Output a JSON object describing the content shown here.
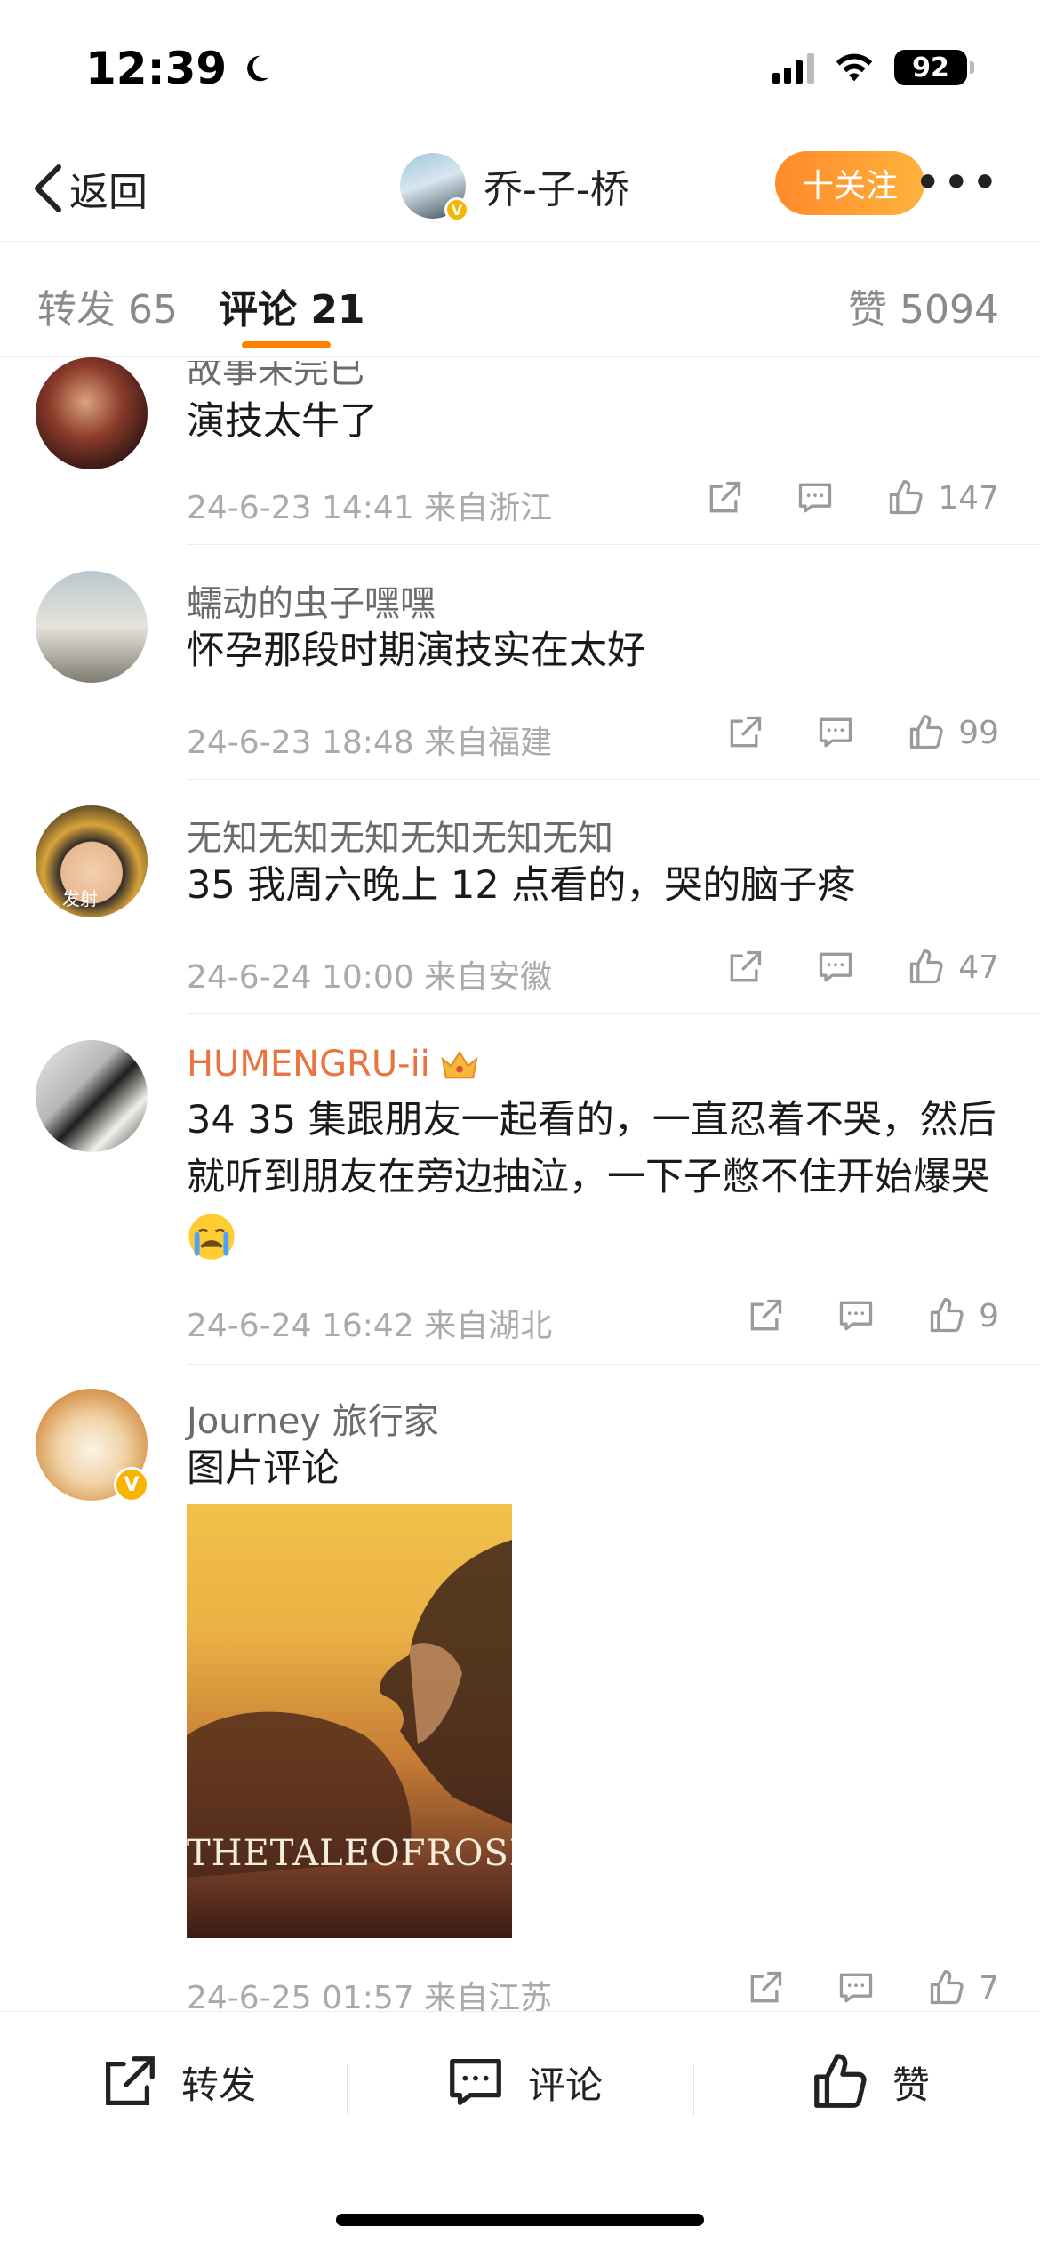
{
  "status_bar": {
    "time": "12:39",
    "battery": "92"
  },
  "nav": {
    "back_label": "返回",
    "username": "乔-子-桥",
    "follow_label": "十关注",
    "more": "•••"
  },
  "tabs": {
    "repost": "转发 65",
    "comments": "评论 21",
    "likes": "赞 5094",
    "accent": "#ff8200"
  },
  "comments": [
    {
      "name": "故事未完已",
      "text": "演技太牛了",
      "date": "24-6-23 14:41",
      "location": "来自浙江",
      "likes": "147"
    },
    {
      "name": "蠕动的虫子嘿嘿",
      "text": "怀孕那段时期演技实在太好",
      "date": "24-6-23 18:48",
      "location": "来自福建",
      "likes": "99"
    },
    {
      "name": "无知无知无知无知无知无知",
      "text": "35 我周六晚上 12 点看的，哭的脑子疼",
      "date": "24-6-24 10:00",
      "location": "来自安徽",
      "likes": "47",
      "avatar_caption": "发射"
    },
    {
      "name": "HUMENGRU-ii",
      "text": "34 35 集跟朋友一起看的，一直忍着不哭，然后就听到朋友在旁边抽泣，一下子憋不住开始爆哭",
      "date": "24-6-24 16:42",
      "location": "来自湖北",
      "likes": "9",
      "name_color": "#eb7340"
    },
    {
      "name": "Journey 旅行家",
      "text": "图片评论",
      "date": "24-6-25 01:57",
      "location": "来自江苏",
      "likes": "7",
      "image_title": "THETALEOFROSE"
    }
  ],
  "bottom_bar": {
    "repost": "转发",
    "comment": "评论",
    "like": "赞"
  }
}
